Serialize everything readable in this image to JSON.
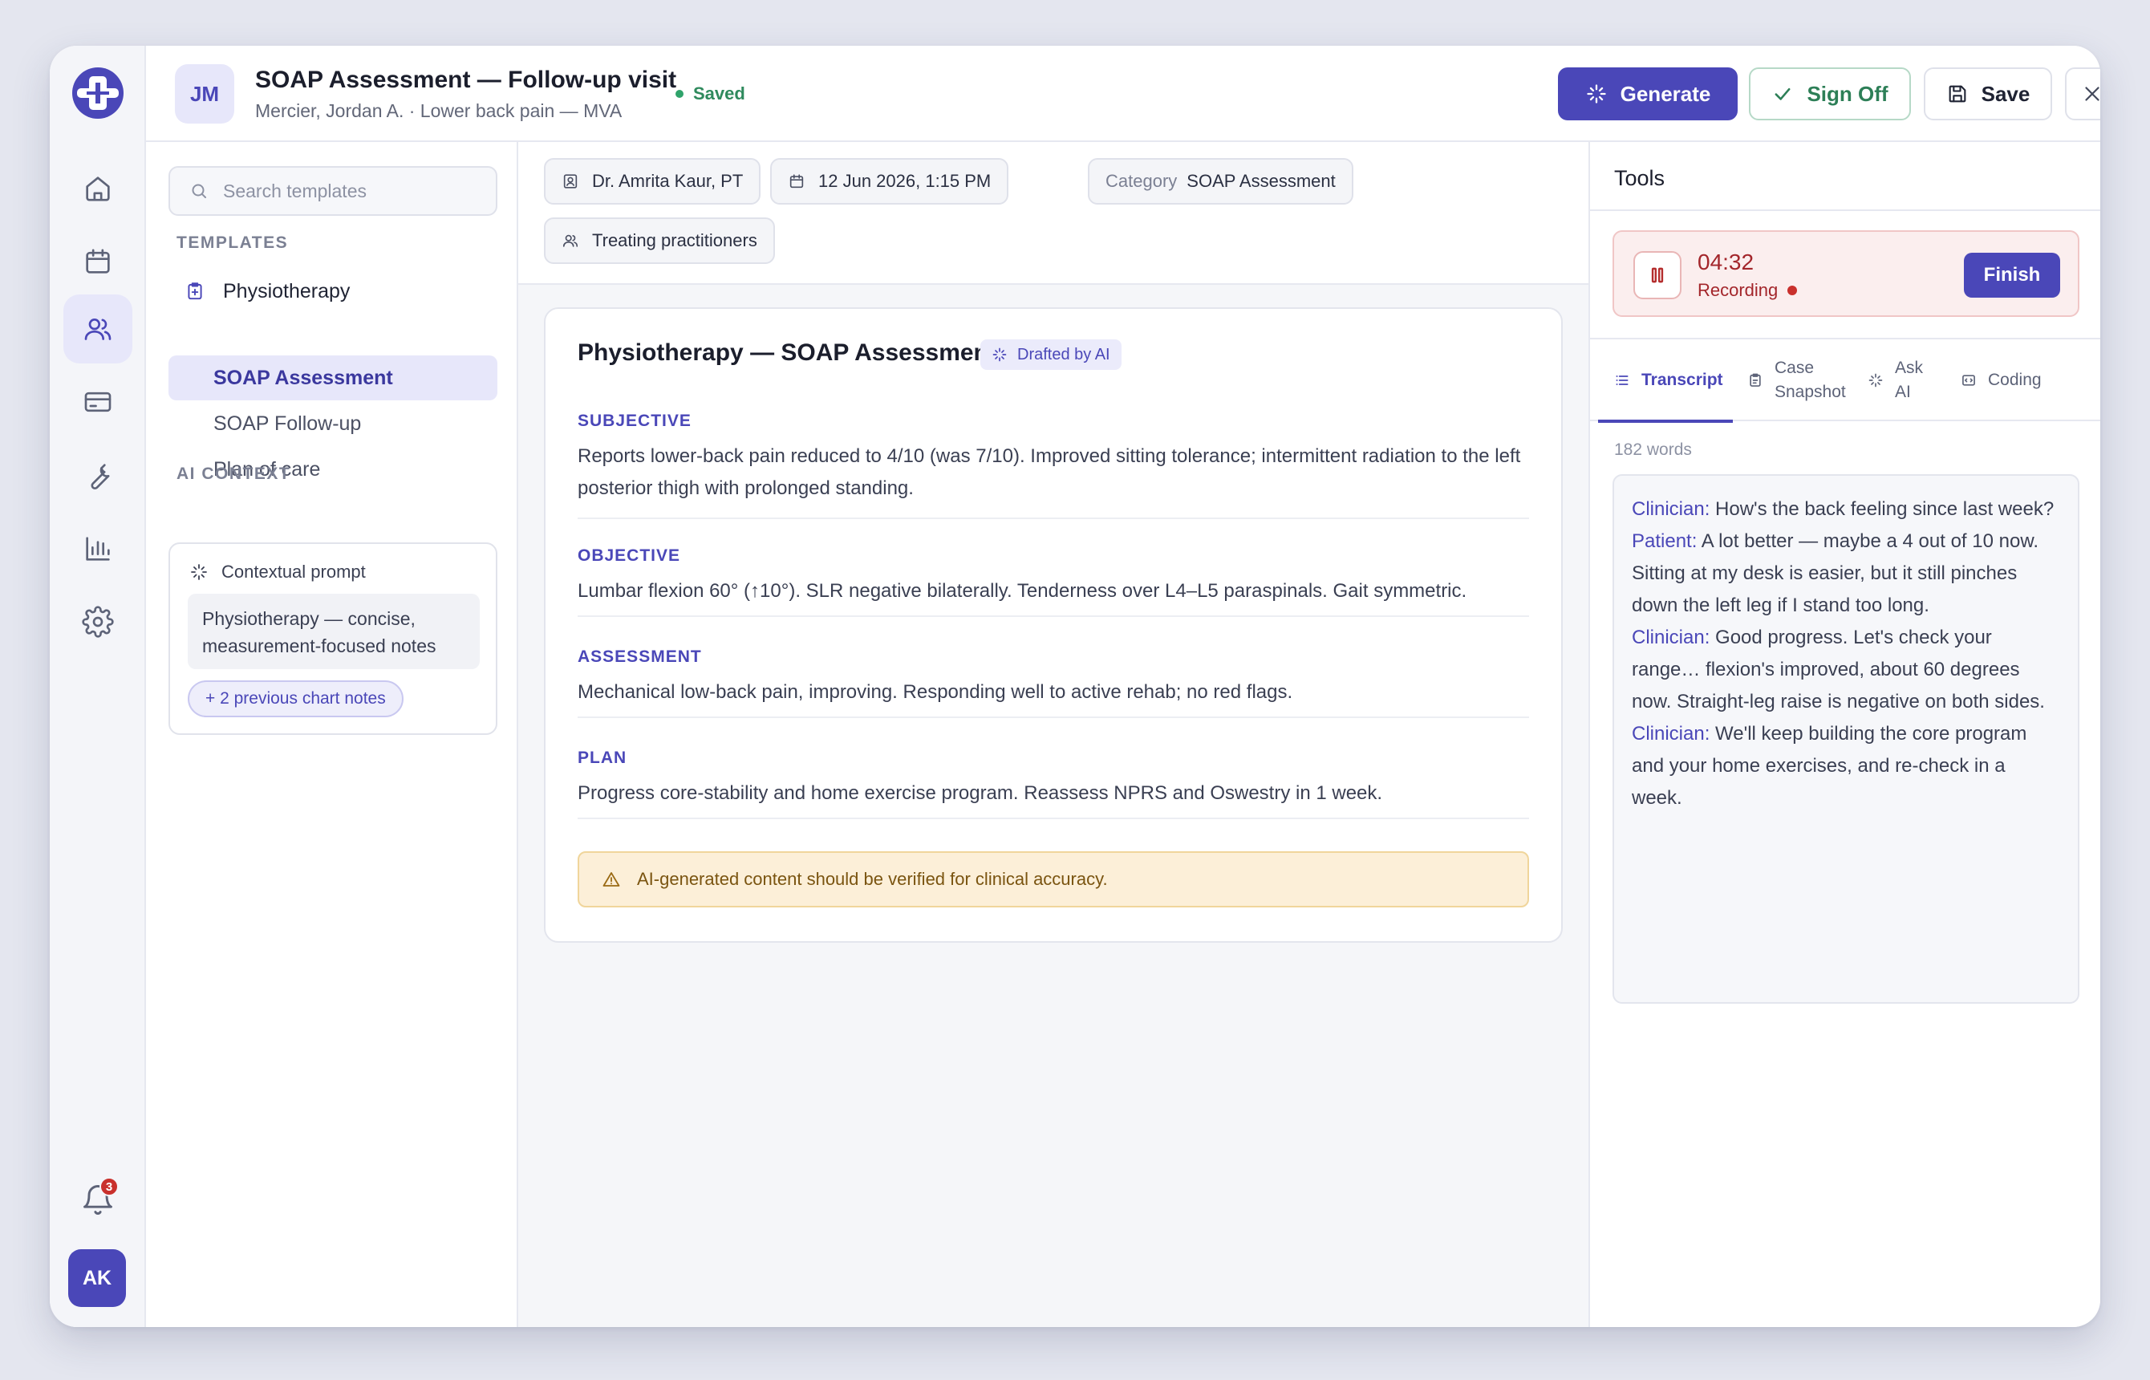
{
  "header": {
    "avatar_initials": "JM",
    "title": "SOAP Assessment — Follow-up visit",
    "subtitle": "Mercier, Jordan A. · Lower back pain — MVA",
    "status": "Saved",
    "generate_label": "Generate",
    "signoff_label": "Sign Off",
    "save_label": "Save"
  },
  "rail": {
    "items": [
      "home-icon",
      "calendar-icon",
      "users-icon",
      "card-icon",
      "wrench-icon",
      "chart-icon",
      "gear-icon"
    ],
    "active": "users-icon",
    "notification_count": "3",
    "user_initials": "AK"
  },
  "templates": {
    "search_placeholder": "Search templates",
    "section_label": "TEMPLATES",
    "group": "Physiotherapy",
    "items": [
      {
        "label": "SOAP Assessment",
        "active": true
      },
      {
        "label": "SOAP Follow-up",
        "active": false
      },
      {
        "label": "Plan of care",
        "active": false
      }
    ],
    "ai_context_label": "AI CONTEXT",
    "contextual_prompt_title": "Contextual prompt",
    "contextual_prompt_text": "Physiotherapy — concise, measurement-focused notes",
    "previous_notes_chip": "+ 2 previous chart notes"
  },
  "meta": {
    "practitioner": "Dr. Amrita Kaur, PT",
    "datetime": "12 Jun 2026, 1:15 PM",
    "category_label": "Category",
    "category_value": "SOAP Assessment",
    "treating": "Treating practitioners"
  },
  "note": {
    "title": "Physiotherapy — SOAP Assessment",
    "badge": "Drafted by AI",
    "sections": [
      {
        "heading": "SUBJECTIVE",
        "body": "Reports lower-back pain reduced to 4/10 (was 7/10). Improved sitting tolerance; intermittent radiation to the left posterior thigh with prolonged standing."
      },
      {
        "heading": "OBJECTIVE",
        "body": "Lumbar flexion 60° (↑10°). SLR negative bilaterally. Tenderness over L4–L5 paraspinals. Gait symmetric."
      },
      {
        "heading": "ASSESSMENT",
        "body": "Mechanical low-back pain, improving. Responding well to active rehab; no red flags."
      },
      {
        "heading": "PLAN",
        "body": "Progress core-stability and home exercise program. Reassess NPRS and Oswestry in 1 week."
      }
    ],
    "warning": "AI-generated content should be verified for clinical accuracy."
  },
  "tools": {
    "title": "Tools",
    "recording_time": "04:32",
    "recording_label": "Recording",
    "finish_label": "Finish",
    "tabs": [
      {
        "label": "Transcript",
        "active": true
      },
      {
        "label": "Case Snapshot",
        "active": false
      },
      {
        "label": "Ask AI",
        "active": false
      },
      {
        "label": "Coding",
        "active": false
      }
    ],
    "word_count": "182 words",
    "transcript": [
      {
        "speaker": "Clinician:",
        "text": " How's the back feeling since last week?"
      },
      {
        "speaker": "Patient:",
        "text": " A lot better — maybe a 4 out of 10 now. Sitting at my desk is easier, but it still pinches down the left leg if I stand too long."
      },
      {
        "speaker": "Clinician:",
        "text": " Good progress. Let's check your range… flexion's improved, about 60 degrees now. Straight-leg raise is negative on both sides."
      },
      {
        "speaker": "Clinician:",
        "text": " We'll keep building the core program and your home exercises, and re-check in a week."
      }
    ]
  },
  "colors": {
    "accent": "#4a47b8",
    "success": "#2f8a5d",
    "recording": "#c9302c",
    "warning_bg": "#fcefd8"
  }
}
